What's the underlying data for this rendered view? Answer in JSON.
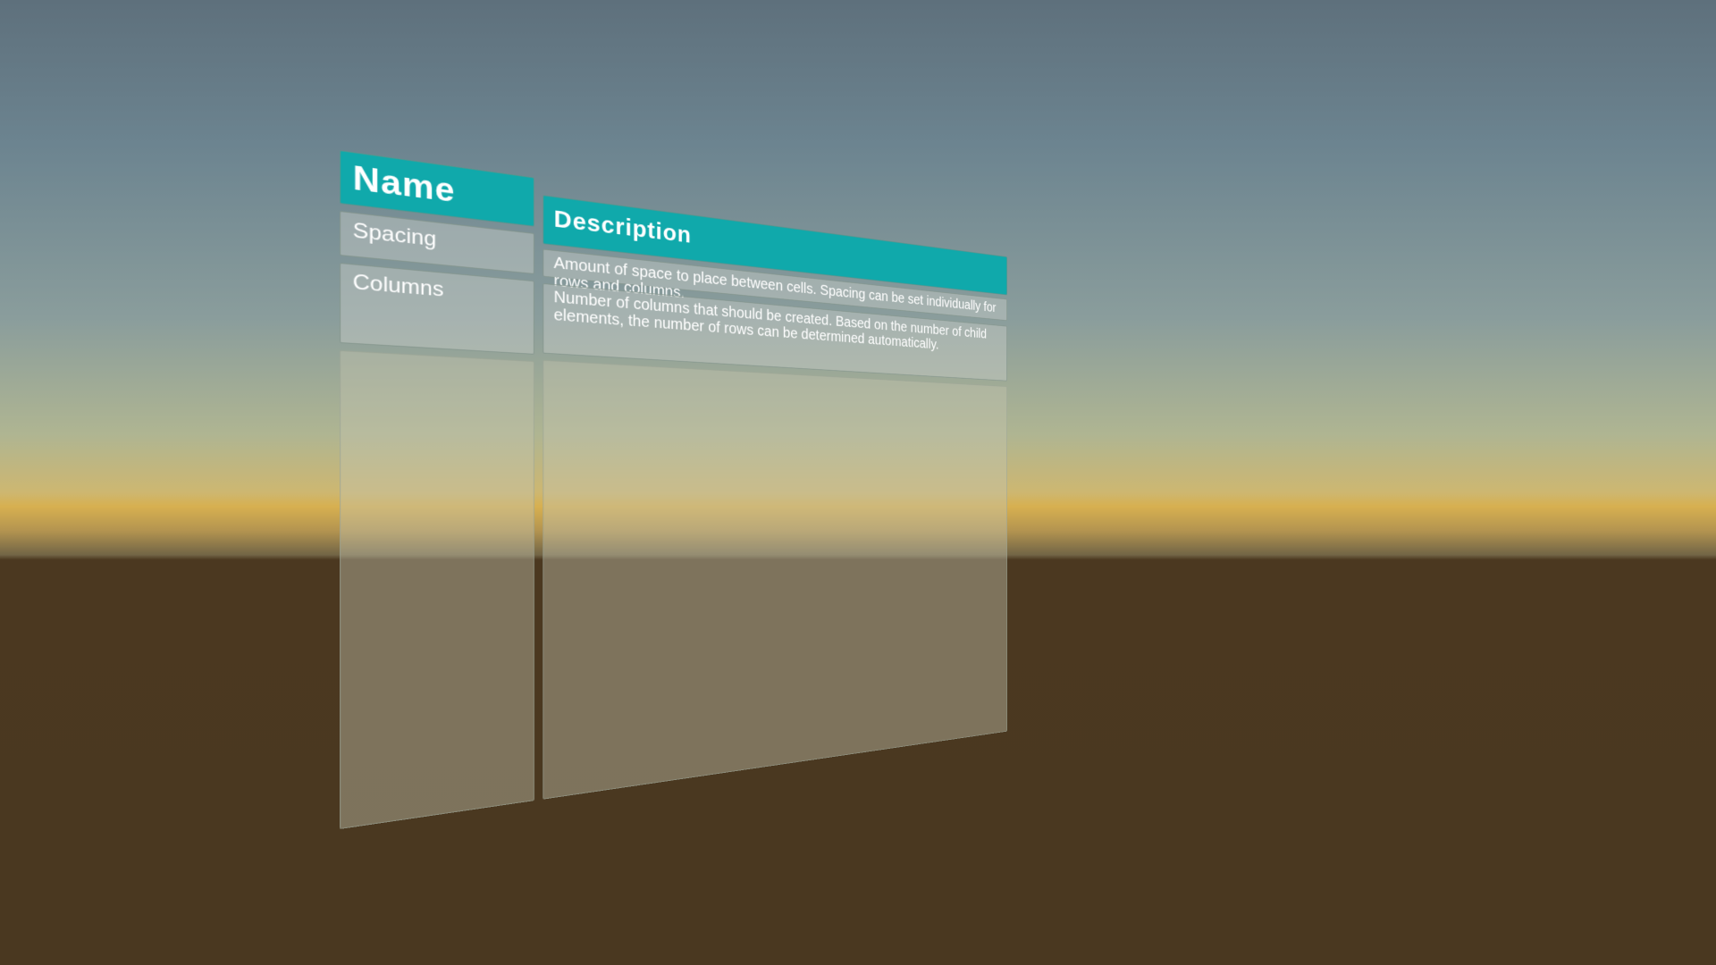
{
  "table": {
    "headers": {
      "name": "Name",
      "description": "Description"
    },
    "rows": [
      {
        "name": "Spacing",
        "description": "Amount of space to place between cells. Spacing can be set individually for rows and columns."
      },
      {
        "name": "Columns",
        "description": "Number of columns that should be created. Based on the number of child elements, the number of rows can be determined automatically."
      }
    ]
  },
  "colors": {
    "header_accent": "#10a9ab",
    "sky_top": "#5e707c",
    "horizon": "#d7b050",
    "ground": "#4a3820"
  }
}
